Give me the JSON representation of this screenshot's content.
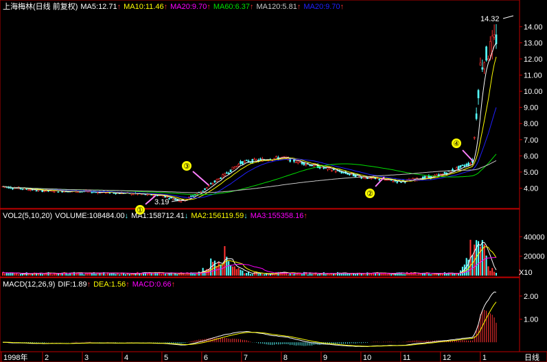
{
  "window": {
    "title": "上海梅林(日线 前复权)",
    "period_label": "日线"
  },
  "colors": {
    "background": "#000000",
    "frame": "#c00000",
    "up": "#ff3232",
    "down": "#54fcfc",
    "ma5": "#ffffff",
    "ma10": "#ffff00",
    "ma20": "#ff00ff",
    "ma60": "#00e000",
    "ma120": "#c8c8c8",
    "ma20b": "#2020ff",
    "marker": "#ffff00",
    "arrow": "#ff80ff",
    "axis_text": "#ffffff"
  },
  "price_legend": [
    {
      "text": "上海梅林(日线 前复权)",
      "color": "#ffffff"
    },
    {
      "text": "MA5:12.71",
      "color": "#ffffff",
      "arrow": "↑"
    },
    {
      "text": "MA10:11.46",
      "color": "#ffff00",
      "arrow": "↑"
    },
    {
      "text": "MA20:9.70",
      "color": "#ff00ff",
      "arrow": "↑"
    },
    {
      "text": "MA60:6.37",
      "color": "#00e000",
      "arrow": "↑"
    },
    {
      "text": "MA120:5.81",
      "color": "#c8c8c8",
      "arrow": "↑"
    },
    {
      "text": "MA20:9.70",
      "color": "#2020ff",
      "arrow": "↑"
    }
  ],
  "volume_legend": [
    {
      "text": "VOL2(5,10,20)",
      "color": "#ffffff"
    },
    {
      "text": "VOLUME:108484.00",
      "color": "#ffffff",
      "arrow": "↓"
    },
    {
      "text": "MA1:158712.41",
      "color": "#ffffff",
      "arrow": "↓"
    },
    {
      "text": "MA2:156119.59",
      "color": "#ffff00",
      "arrow": "↓"
    },
    {
      "text": "MA3:155358.16",
      "color": "#ff00ff",
      "arrow": "↑"
    }
  ],
  "macd_legend": [
    {
      "text": "MACD(12,26,9)",
      "color": "#ffffff"
    },
    {
      "text": "DIF:1.89",
      "color": "#ffffff",
      "arrow": "↑"
    },
    {
      "text": "DEA:1.56",
      "color": "#ffff00",
      "arrow": "↑"
    },
    {
      "text": "MACD:0.66",
      "color": "#ff00ff",
      "arrow": "↑"
    }
  ],
  "annotations": {
    "high_label": "14.32",
    "low_label": "3.19",
    "markers": [
      "①",
      "②",
      "③",
      "④"
    ]
  },
  "chart_data": [
    {
      "type": "candlestick",
      "panel": "price",
      "y_ticks": [
        4.0,
        5.0,
        6.0,
        7.0,
        8.0,
        9.0,
        10.0,
        11.0,
        12.0,
        13.0,
        14.0
      ],
      "ylim": [
        3.0,
        14.8
      ],
      "x_ticks": [
        "1998年",
        "2",
        "3",
        "4",
        "5",
        "6",
        "7",
        "8",
        "9",
        "10",
        "11",
        "12",
        "1"
      ],
      "key_points": [
        {
          "month": 1,
          "close": 4.1
        },
        {
          "month": 2,
          "close": 3.85
        },
        {
          "month": 3,
          "close": 3.8
        },
        {
          "month": 4,
          "close": 3.7
        },
        {
          "month": 5,
          "close": 3.55
        },
        {
          "month": 5.5,
          "close": 3.19
        },
        {
          "month": 6,
          "close": 3.8
        },
        {
          "month": 7,
          "close": 5.6
        },
        {
          "month": 8,
          "close": 5.9
        },
        {
          "month": 9,
          "close": 5.3
        },
        {
          "month": 10,
          "close": 4.7
        },
        {
          "month": 11,
          "close": 4.4
        },
        {
          "month": 12,
          "close": 4.8
        },
        {
          "month": 12.8,
          "close": 5.6
        },
        {
          "month": 13,
          "close": 11.5
        },
        {
          "month": 13.4,
          "close": 13.3
        }
      ],
      "high": 14.32,
      "low": 3.19,
      "series": [
        {
          "name": "MA5",
          "last": 12.71
        },
        {
          "name": "MA10",
          "last": 11.46
        },
        {
          "name": "MA20",
          "last": 9.7
        },
        {
          "name": "MA60",
          "last": 6.37
        },
        {
          "name": "MA120",
          "last": 5.81
        }
      ]
    },
    {
      "type": "bar",
      "panel": "volume",
      "y_ticks": [
        20000,
        40000
      ],
      "unit_label": "X10",
      "series": [
        {
          "name": "VOLUME",
          "last": 108484.0
        },
        {
          "name": "MA1",
          "last": 158712.41
        },
        {
          "name": "MA2",
          "last": 156119.59
        },
        {
          "name": "MA3",
          "last": 155358.16
        }
      ],
      "peaks": [
        {
          "month": 6.5,
          "value": 27000
        },
        {
          "month": 12.9,
          "value": 52000
        }
      ]
    },
    {
      "type": "line",
      "panel": "macd",
      "y_ticks": [
        1.0,
        2.0
      ],
      "series": [
        {
          "name": "DIF",
          "last": 1.89
        },
        {
          "name": "DEA",
          "last": 1.56
        },
        {
          "name": "MACD",
          "last": 0.66
        }
      ]
    }
  ]
}
